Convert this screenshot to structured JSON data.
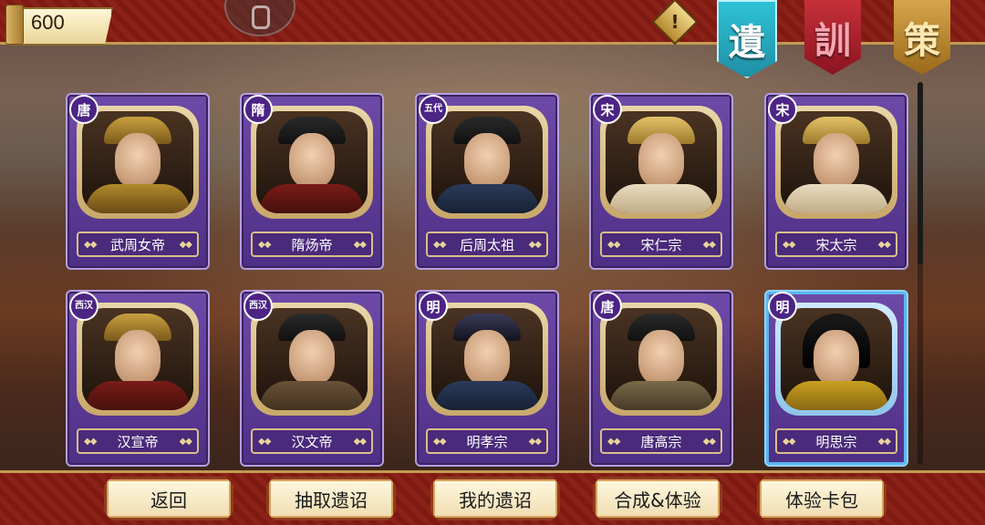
{
  "currency": {
    "gold": "600"
  },
  "top_banners": [
    {
      "label": "遺",
      "icon": "teal-banner"
    },
    {
      "label": "訓",
      "icon": "red-banner"
    },
    {
      "label": "策",
      "icon": "gold-banner"
    }
  ],
  "alert": {
    "label": "!"
  },
  "cards": [
    {
      "dynasty": "唐",
      "name": "武周女帝"
    },
    {
      "dynasty": "隋",
      "name": "隋炀帝"
    },
    {
      "dynasty": "五代",
      "name": "后周太祖"
    },
    {
      "dynasty": "宋",
      "name": "宋仁宗"
    },
    {
      "dynasty": "宋",
      "name": "宋太宗"
    },
    {
      "dynasty": "西汉",
      "name": "汉宣帝"
    },
    {
      "dynasty": "西汉",
      "name": "汉文帝"
    },
    {
      "dynasty": "明",
      "name": "明孝宗"
    },
    {
      "dynasty": "唐",
      "name": "唐高宗"
    },
    {
      "dynasty": "明",
      "name": "明思宗"
    }
  ],
  "bottom_buttons": {
    "back": "返回",
    "draw": "抽取遗诏",
    "mine": "我的遗诏",
    "compose": "合成&体验",
    "trial_pack": "体验卡包"
  }
}
